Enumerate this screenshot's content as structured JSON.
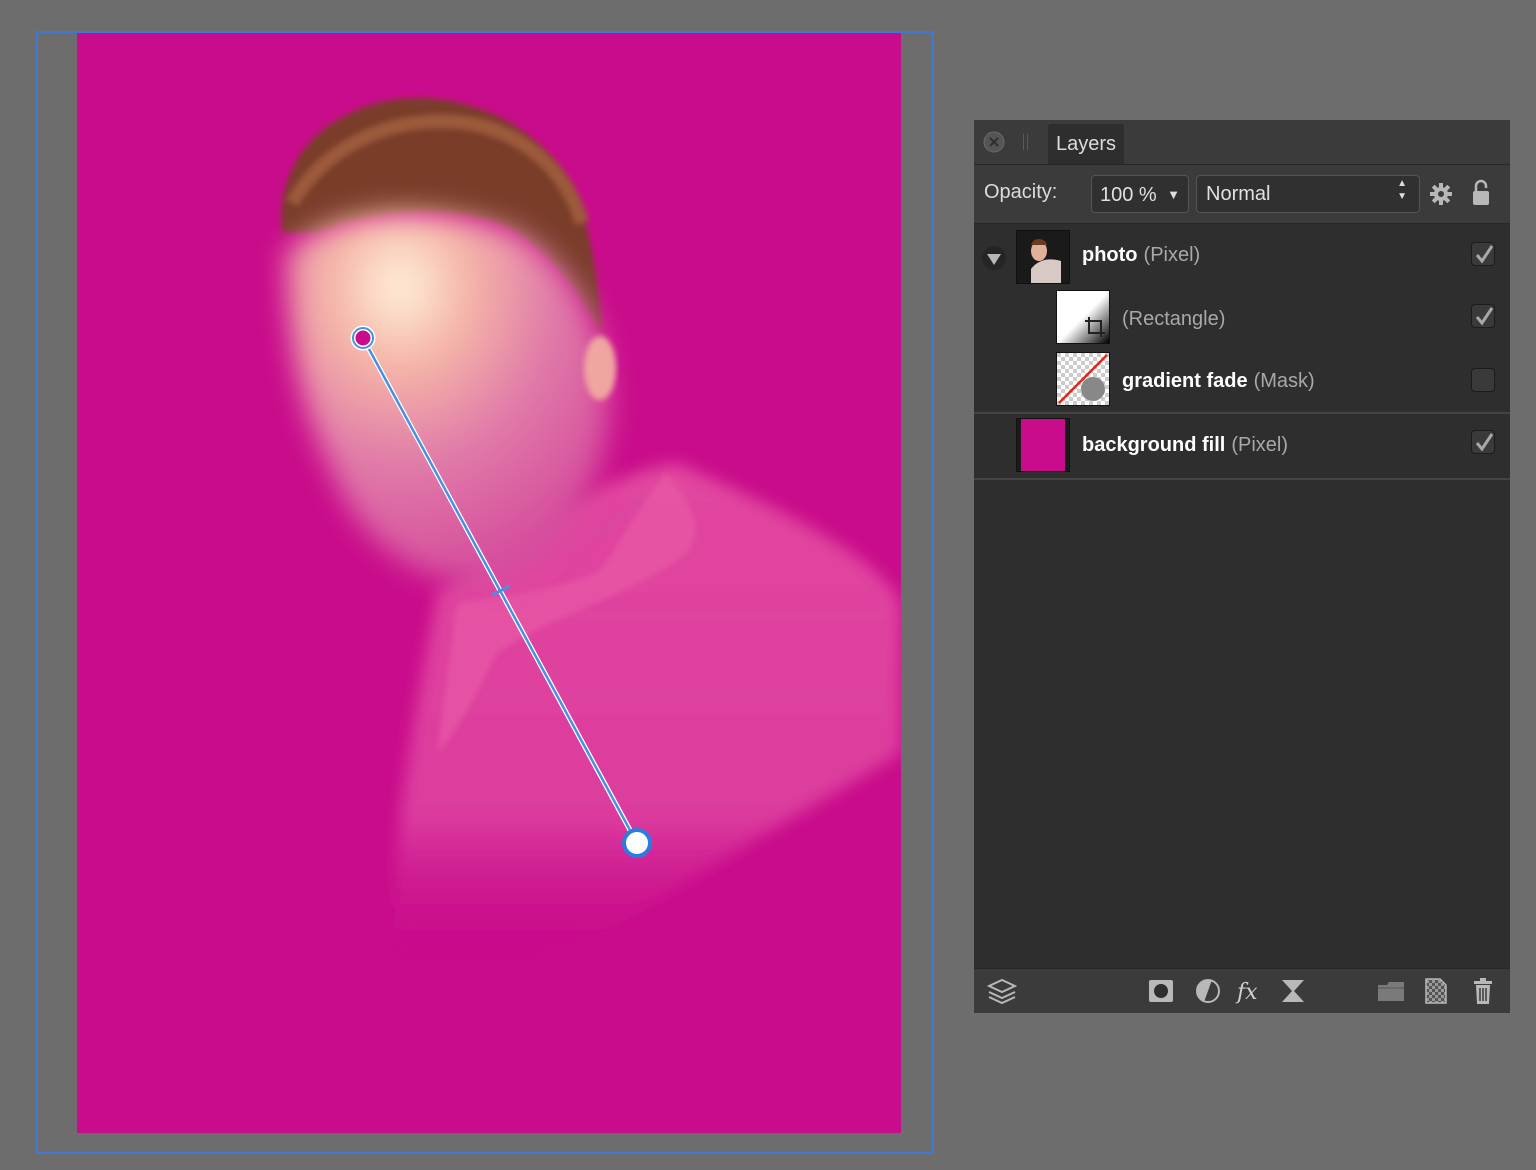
{
  "canvas": {
    "background_color": "#c90c8b",
    "selection_color": "#3f78d6"
  },
  "gradient_tool": {
    "line_color": "#4a90e2",
    "start_handle_color": "#c90c8b",
    "end_handle_color": "#ffffff"
  },
  "layers_panel": {
    "close_icon": "close-icon",
    "tab_label": "Layers",
    "opacity_label": "Opacity:",
    "opacity_value": "100 %",
    "blend_mode": "Normal",
    "settings_icon": "gear-icon",
    "lock_icon": "lock-icon",
    "layers": [
      {
        "name": "photo",
        "type": "(Pixel)",
        "visible": true,
        "expanded": true
      },
      {
        "name": "",
        "type": "(Rectangle)",
        "visible": true,
        "child": true
      },
      {
        "name": "gradient fade",
        "type": "(Mask)",
        "visible": false,
        "child": true
      },
      {
        "name": "background fill",
        "type": "(Pixel)",
        "visible": true
      }
    ],
    "bottom_tools": [
      "layers-stack-icon",
      "mask-icon",
      "adjustment-icon",
      "fx-icon",
      "live-filter-icon",
      "folder-icon",
      "new-layer-icon",
      "trash-icon"
    ]
  }
}
